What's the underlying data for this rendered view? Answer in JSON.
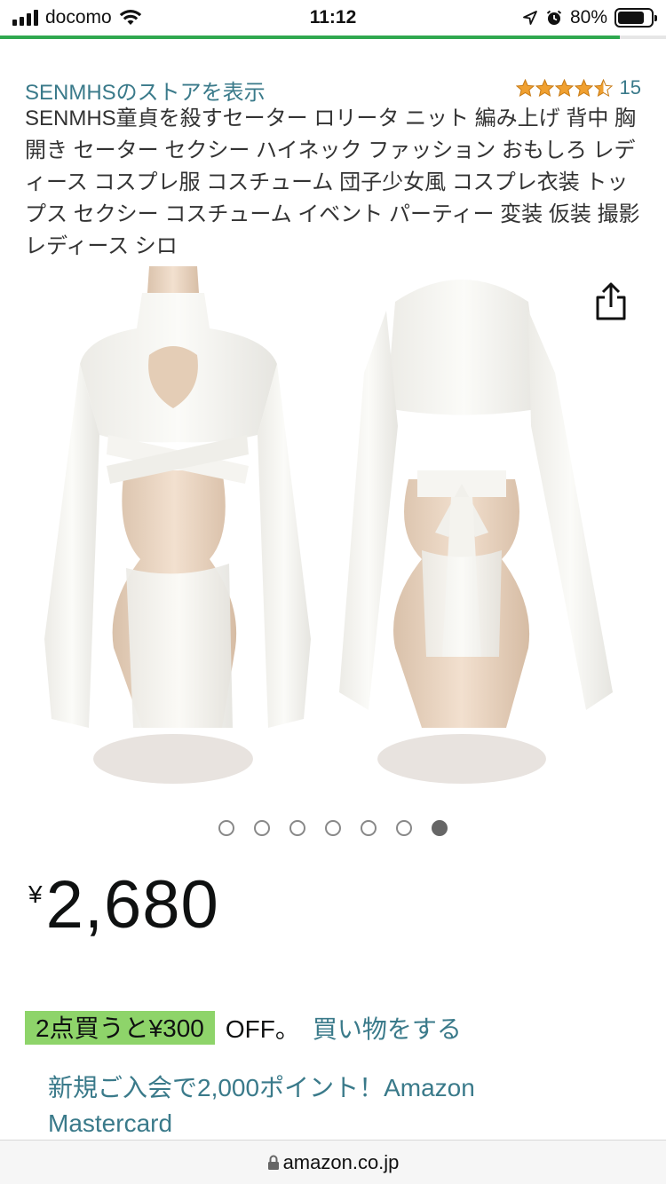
{
  "status_bar": {
    "carrier": "docomo",
    "time": "11:12",
    "battery_percent": "80%",
    "battery_level": 0.8,
    "icons": [
      "signal-icon",
      "wifi-icon",
      "location-icon",
      "alarm-icon",
      "battery-icon"
    ]
  },
  "page_load_progress": 0.93,
  "product": {
    "store_link": "SENMHSのストアを表示",
    "rating": 4.5,
    "review_count": "15",
    "title": "SENMHS童貞を殺すセーター ロリータ ニット 編み上げ 背中 胸 開き セーター セクシー ハイネック ファッション おもしろ レディース コスプレ服 コスチューム 団子少女風 コスプレ衣装 トップス セクシー コスチューム イベント パーティー 変装 仮装 撮影レディース シロ",
    "image_count": 7,
    "active_image_index": 6,
    "price_symbol": "¥",
    "price": "2,680"
  },
  "promo": {
    "badge": "2点買うと¥300",
    "off": "OFF。",
    "link": "買い物をする",
    "badge_color": "#8ed46a"
  },
  "card_offer": {
    "text": "新規ご入会で2,000ポイント！Amazon Mastercard"
  },
  "url_bar": {
    "url": "amazon.co.jp"
  },
  "colors": {
    "link": "#3a7a8a",
    "star": "#f0a030",
    "progress": "#2fa84f"
  }
}
